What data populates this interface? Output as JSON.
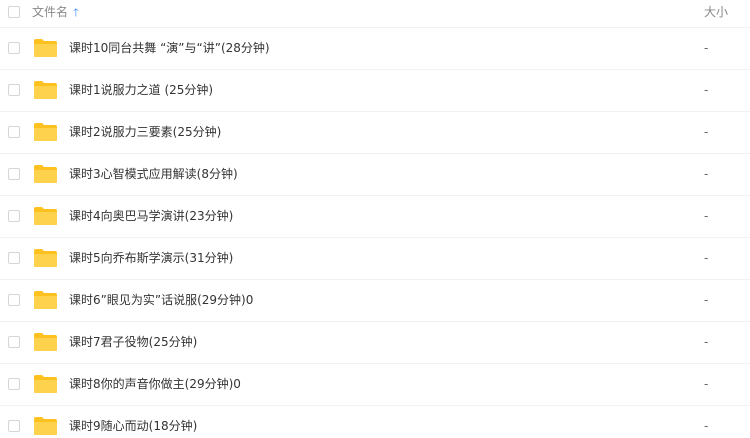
{
  "header": {
    "name_label": "文件名",
    "sort_icon": "arrow-up-icon",
    "size_label": "大小"
  },
  "colors": {
    "folder": "#ffd24d",
    "folder_tab": "#ffc11f",
    "sort_arrow": "#3b8cff"
  },
  "files": [
    {
      "name": "课时10同台共舞 “演”与“讲”(28分钟)",
      "size": "-"
    },
    {
      "name": "课时1说服力之道 (25分钟)",
      "size": "-"
    },
    {
      "name": "课时2说服力三要素(25分钟)",
      "size": "-"
    },
    {
      "name": "课时3心智模式应用解读(8分钟)",
      "size": "-"
    },
    {
      "name": "课时4向奥巴马学演讲(23分钟)",
      "size": "-"
    },
    {
      "name": "课时5向乔布斯学演示(31分钟)",
      "size": "-"
    },
    {
      "name": "课时6”眼见为实”话说服(29分钟)0",
      "size": "-"
    },
    {
      "name": "课时7君子役物(25分钟)",
      "size": "-"
    },
    {
      "name": "课时8你的声音你做主(29分钟)0",
      "size": "-"
    },
    {
      "name": "课时9随心而动(18分钟)",
      "size": "-"
    }
  ]
}
